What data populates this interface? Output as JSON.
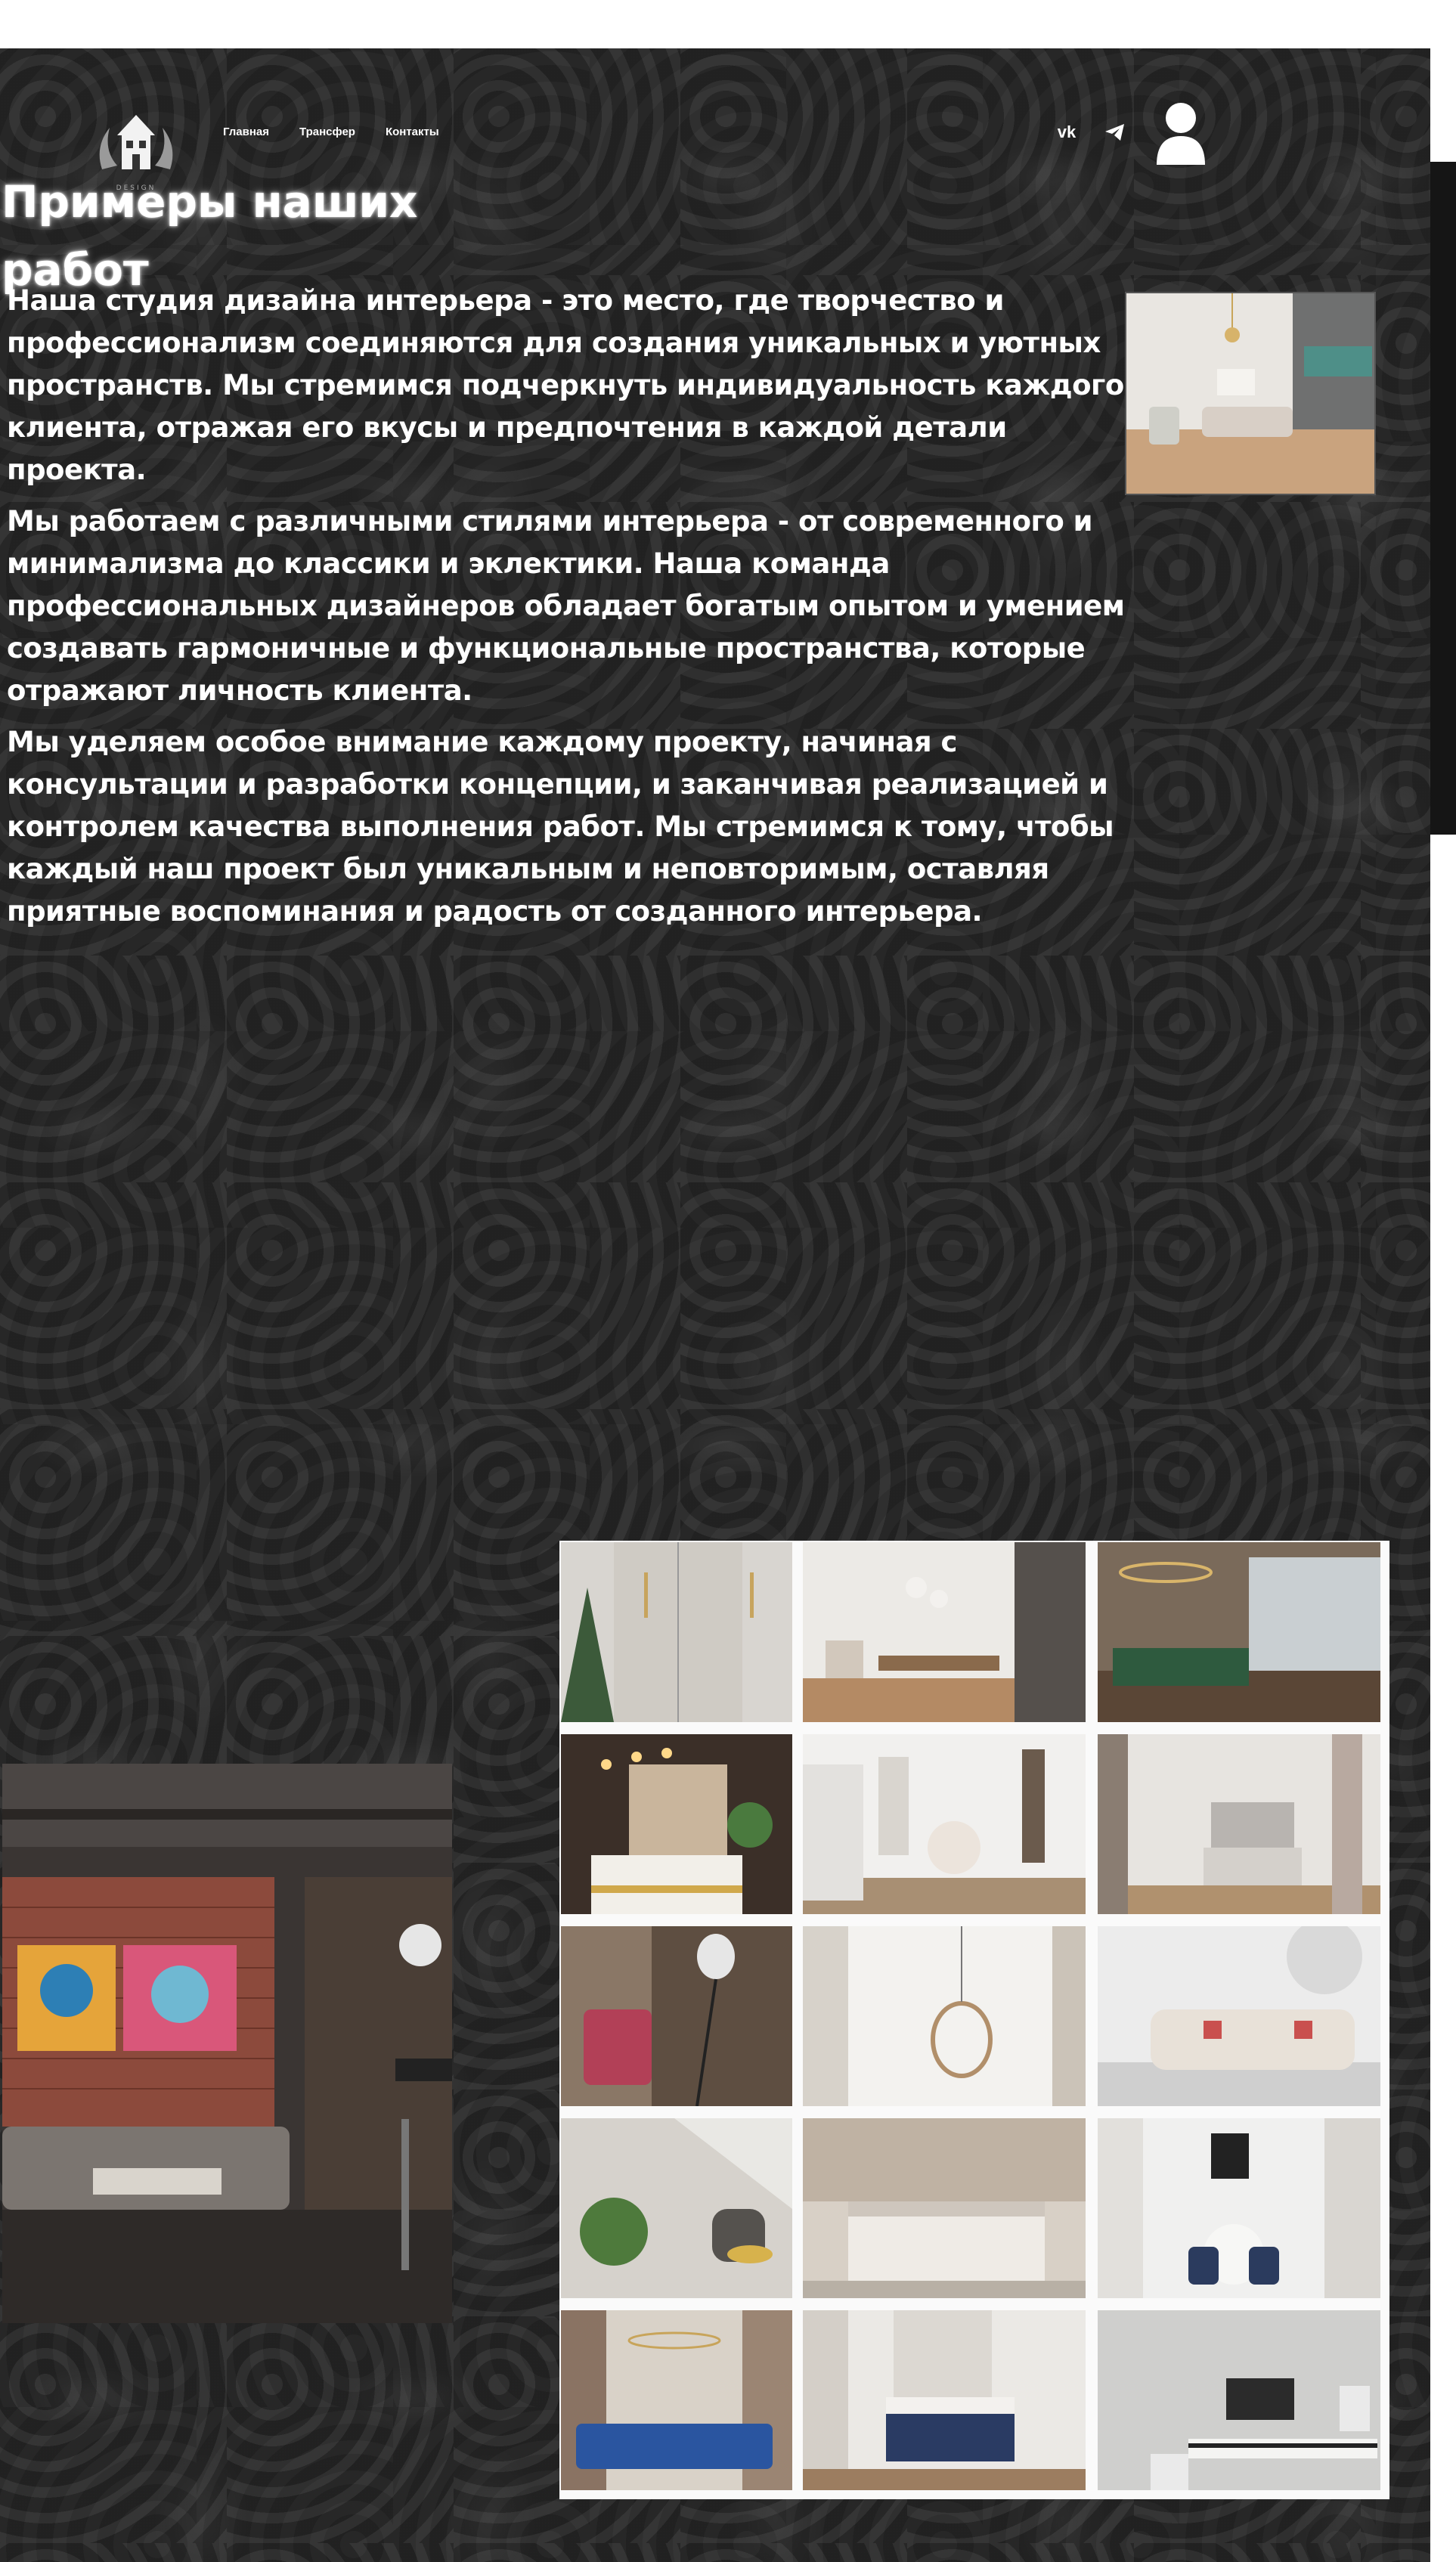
{
  "header": {
    "logo_text": "DESIGN",
    "nav": [
      "Главная",
      "Трансфер",
      "Контакты"
    ],
    "social": {
      "vk_icon": "vk-icon",
      "telegram_icon": "telegram-icon",
      "profile_icon": "user-icon"
    }
  },
  "main": {
    "title": "Примеры наших работ",
    "paragraphs": [
      "Наша студия дизайна интерьера - это место, где творчество и профессионализм соединяются для создания уникальных и уютных пространств. Мы стремимся подчеркнуть индивидуальность каждого клиента, отражая его вкусы и предпочтения в каждой детали проекта.",
      "Мы работаем с различными стилями интерьера - от современного и минимализма до классики и эклектики. Наша команда профессиональных дизайнеров обладает богатым опытом и умением создавать гармоничные и функциональные пространства, которые отражают личность клиента.",
      "Мы уделяем особое внимание каждому проекту, начиная с консультации и разработки концепции, и заканчивая реализацией и контролем качества выполнения работ. Мы стремимся к тому, чтобы каждый наш проект был уникальным и неповторимым, оставляя приятные воспоминания и радость от созданного интерьера."
    ]
  },
  "colors": {
    "background": "#232323",
    "text": "#ffffff",
    "gallery_bg": "#fafafa"
  }
}
